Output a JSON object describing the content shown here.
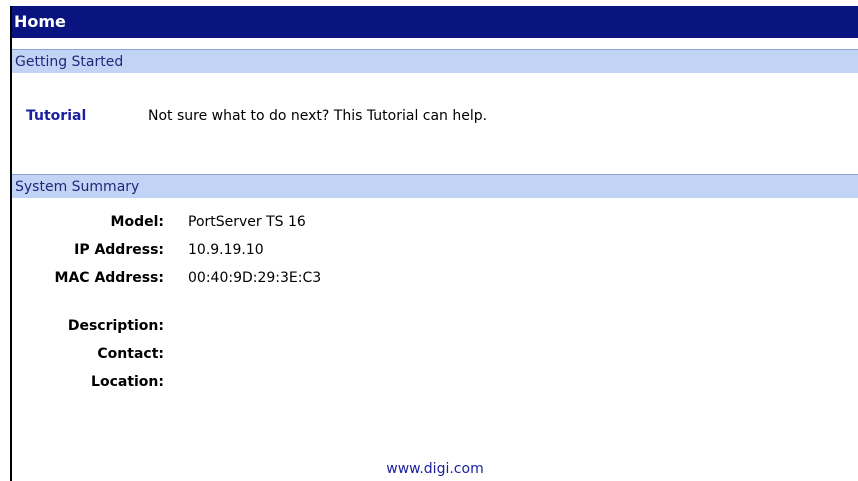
{
  "header": {
    "title": "Home"
  },
  "getting_started": {
    "heading": "Getting Started",
    "tutorial_link": "Tutorial",
    "tutorial_text": "Not sure what to do next? This Tutorial can help."
  },
  "system_summary": {
    "heading": "System Summary",
    "rows": [
      {
        "label": "Model:",
        "value": "PortServer TS 16"
      },
      {
        "label": "IP Address:",
        "value": "10.9.19.10"
      },
      {
        "label": "MAC Address:",
        "value": "00:40:9D:29:3E:C3"
      },
      {
        "label": "Description:",
        "value": ""
      },
      {
        "label": "Contact:",
        "value": ""
      },
      {
        "label": "Location:",
        "value": ""
      }
    ]
  },
  "footer": {
    "link": "www.digi.com"
  },
  "colors": {
    "title_bar": "#0a1480",
    "section_header": "#c2d4f6",
    "link": "#1a1fa0"
  }
}
